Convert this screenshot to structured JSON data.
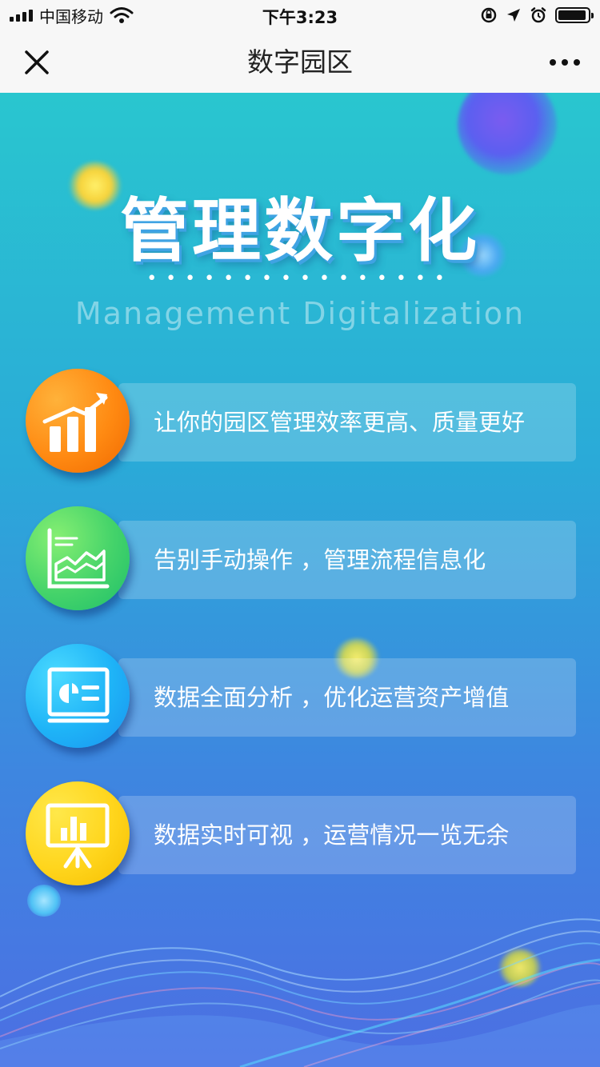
{
  "status_bar": {
    "carrier": "中国移动",
    "time": "下午3:23",
    "battery_level": 0.9
  },
  "nav": {
    "title": "数字园区",
    "close_icon": "close-icon",
    "more_icon": "more-icon"
  },
  "hero": {
    "title": "管理数字化",
    "dots": "••••••••••••••••",
    "subtitle": "Management Digitalization"
  },
  "features": [
    {
      "icon": "growth-chart-icon",
      "text": "让你的园区管理效率更高、质量更好"
    },
    {
      "icon": "area-chart-icon",
      "text": "告别手动操作 ，管理流程信息化"
    },
    {
      "icon": "dashboard-icon",
      "text": "数据全面分析 ，优化运营资产增值"
    },
    {
      "icon": "presentation-icon",
      "text": "数据实时可视 ，运营情况一览无余"
    }
  ],
  "colors": {
    "orange": "#ff8a12",
    "green": "#44d36a",
    "blue": "#1eb3f7",
    "yellow": "#ffd51c"
  }
}
